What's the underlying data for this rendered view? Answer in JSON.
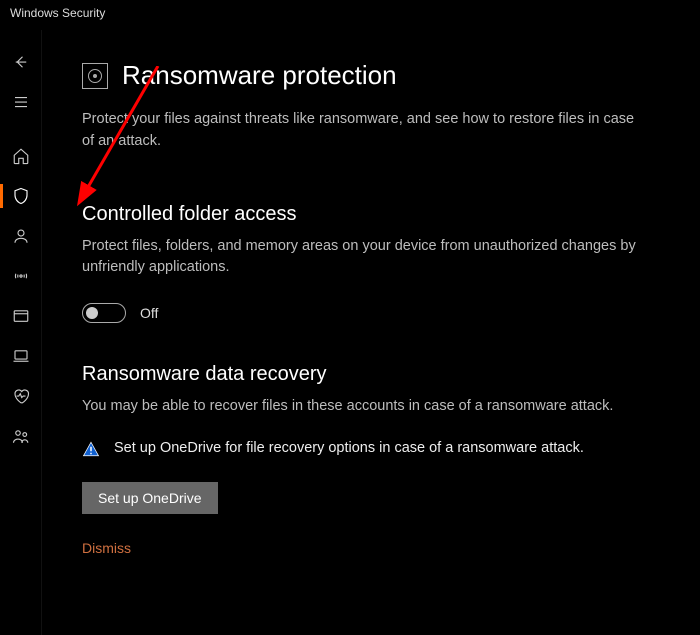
{
  "window": {
    "title": "Windows Security"
  },
  "page": {
    "title": "Ransomware protection",
    "description": "Protect your files against threats like ransomware, and see how to restore files in case of an attack."
  },
  "sections": {
    "cfa": {
      "heading": "Controlled folder access",
      "description": "Protect files, folders, and memory areas on your device from unauthorized changes by unfriendly applications.",
      "toggle_state": "Off"
    },
    "recovery": {
      "heading": "Ransomware data recovery",
      "description": "You may be able to recover files in these accounts in case of a ransomware attack.",
      "alert": "Set up OneDrive for file recovery options in case of a ransomware attack.",
      "button": "Set up OneDrive",
      "dismiss": "Dismiss"
    }
  }
}
